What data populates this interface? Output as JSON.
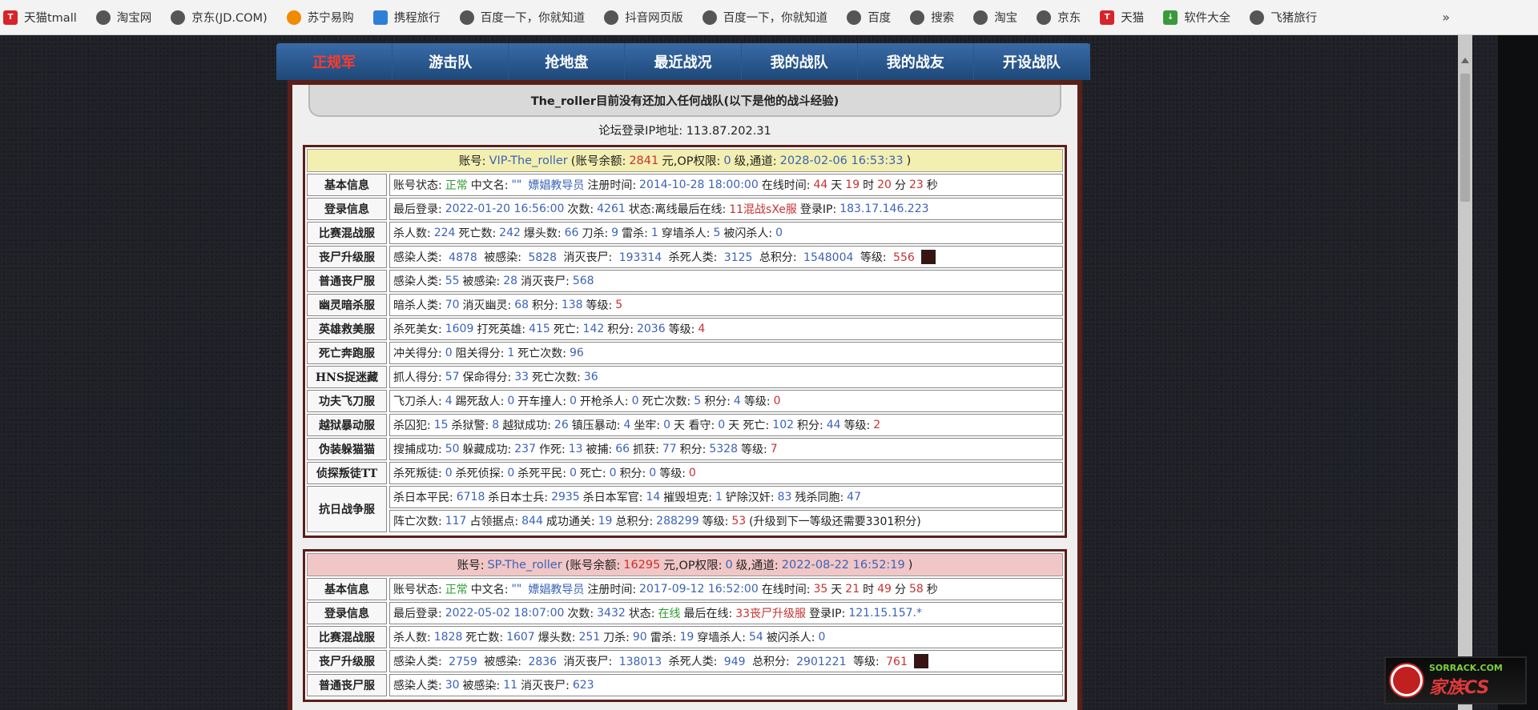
{
  "bookmarks": [
    {
      "label": "天猫tmall",
      "icon": "tmall-icon"
    },
    {
      "label": "淘宝网",
      "icon": "globe-icon"
    },
    {
      "label": "京东(JD.COM)",
      "icon": "globe-icon"
    },
    {
      "label": "苏宁易购",
      "icon": "suning-icon"
    },
    {
      "label": "携程旅行",
      "icon": "ctrip-icon"
    },
    {
      "label": "百度一下，你就知道",
      "icon": "globe-icon"
    },
    {
      "label": "抖音网页版",
      "icon": "globe-icon"
    },
    {
      "label": "百度一下，你就知道",
      "icon": "globe-icon"
    },
    {
      "label": "百度",
      "icon": "globe-icon"
    },
    {
      "label": "搜索",
      "icon": "globe-icon"
    },
    {
      "label": "淘宝",
      "icon": "globe-icon"
    },
    {
      "label": "京东",
      "icon": "globe-icon"
    },
    {
      "label": "天猫",
      "icon": "tmall-icon"
    },
    {
      "label": "软件大全",
      "icon": "download-icon"
    },
    {
      "label": "飞猪旅行",
      "icon": "globe-icon"
    }
  ],
  "bookmarks_more": "»",
  "nav": {
    "tabs": [
      "正规军",
      "游击队",
      "抢地盘",
      "最近战况",
      "我的战队",
      "我的战友",
      "开设战队"
    ],
    "active_index": 0
  },
  "panel": {
    "title": "The_roller目前没有还加入任何战队(以下是他的战斗经验)",
    "ip_label": "论坛登录IP地址:",
    "ip_value": "113.87.202.31"
  },
  "vip": {
    "head": {
      "prefix": "账号:",
      "account": "VIP-The_roller",
      "balance_label": "(账号余额:",
      "balance": "2841",
      "balance_unit": "元,",
      "op_label": "OP权限:",
      "op": "0",
      "op_unit": "级,",
      "channel_label": "通道:",
      "channel": "2028-02-06 16:53:33",
      "close": ")"
    },
    "basic": {
      "label": "基本信息",
      "status_label": "账号状态:",
      "status": "正常",
      "cn_label": "中文名:",
      "cn_quote": "\"\"",
      "cn": "嫖娼教导员",
      "reg_label": "注册时间:",
      "reg": "2014-10-28 18:00:00",
      "online_label": "在线时间:",
      "online_days": "44",
      "online_h": "19",
      "online_m": "20",
      "online_s": "23"
    },
    "login": {
      "label": "登录信息",
      "last_label": "最后登录:",
      "last": "2022-01-20 16:56:00",
      "count_label": "次数:",
      "count": "4261",
      "state_label": "状态:",
      "state": "离线",
      "last_online_label": "最后在线:",
      "last_online": "11混战sXe服",
      "login_ip_label": "登录IP:",
      "login_ip": "183.17.146.223"
    },
    "rows": [
      {
        "label": "比赛混战服",
        "text": "杀人数: 224 死亡数: 242 爆头数: 66 刀杀: 9 雷杀: 1 穿墙杀人: 5 被闪杀人: 0"
      },
      {
        "label": "丧尸升级服",
        "text": "感染人类: 4878 被感染: 5828 消灭丧尸: 193314 杀死人类: 3125 总积分: 1548004 等级: 556"
      },
      {
        "label": "普通丧尸服",
        "text": "感染人类: 55 被感染: 28 消灭丧尸: 568"
      },
      {
        "label": "幽灵暗杀服",
        "text": "暗杀人类: 70 消灭幽灵: 68 积分: 138 等级: 5"
      },
      {
        "label": "英雄救美服",
        "text": "杀死美女: 1609 打死英雄: 415 死亡: 142 积分: 2036 等级: 4"
      },
      {
        "label": "死亡奔跑服",
        "text": "冲关得分: 0 阻关得分: 1 死亡次数: 96"
      },
      {
        "label": "HNS捉迷藏",
        "text": "抓人得分: 57 保命得分: 33 死亡次数: 36"
      },
      {
        "label": "功夫飞刀服",
        "text": "飞刀杀人: 4 踢死敌人: 0 开车撞人: 0 开枪杀人: 0 死亡次数: 5 积分: 4 等级: 0"
      },
      {
        "label": "越狱暴动服",
        "text": "杀囚犯: 15 杀狱警: 8 越狱成功: 26 镇压暴动: 4 坐牢: 0天 看守: 0天 死亡: 102 积分: 44 等级: 2"
      },
      {
        "label": "伪装躲猫猫",
        "text": "搜捕成功: 50 躲藏成功: 237 作死: 13 被捕: 66 抓获: 77 积分: 5328 等级: 7"
      },
      {
        "label": "侦探叛徒TT",
        "text": "杀死叛徒: 0 杀死侦探: 0 杀死平民: 0 死亡: 0 积分: 0 等级: 0"
      }
    ],
    "kangri": {
      "label": "抗日战争服",
      "line1": "杀日本平民: 6718 杀日本士兵: 2935 杀日本军官: 14 摧毁坦克: 1 铲除汉奸: 83 残杀同胞: 47",
      "line2": "阵亡次数: 117 占领据点: 844 成功通关: 19 总积分: 288299 等级: 53 (升级到下一等级还需要3301积分)"
    }
  },
  "sp": {
    "head": {
      "prefix": "账号:",
      "account": "SP-The_roller",
      "balance_label": "(账号余额:",
      "balance": "16295",
      "balance_unit": "元,",
      "op_label": "OP权限:",
      "op": "0",
      "op_unit": "级,",
      "channel_label": "通道:",
      "channel": "2022-08-22 16:52:19",
      "close": ")"
    },
    "basic": {
      "label": "基本信息",
      "status_label": "账号状态:",
      "status": "正常",
      "cn_label": "中文名:",
      "cn_quote": "\"\"",
      "cn": "嫖娼教导员",
      "reg_label": "注册时间:",
      "reg": "2017-09-12 16:52:00",
      "online_label": "在线时间:",
      "online_days": "35",
      "online_h": "21",
      "online_m": "49",
      "online_s": "58"
    },
    "login": {
      "label": "登录信息",
      "last_label": "最后登录:",
      "last": "2022-05-02 18:07:00",
      "count_label": "次数:",
      "count": "3432",
      "state_label": "状态:",
      "state": "在线",
      "last_online_label": "最后在线:",
      "last_online": "33丧尸升级服",
      "login_ip_label": "登录IP:",
      "login_ip": "121.15.157.*"
    },
    "rows": [
      {
        "label": "比赛混战服",
        "text": "杀人数: 1828 死亡数: 1607 爆头数: 251 刀杀: 90 雷杀: 19 穿墙杀人: 54 被闪杀人: 0"
      },
      {
        "label": "丧尸升级服",
        "text": "感染人类: 2759 被感染: 2836 消灭丧尸: 138013 杀死人类: 949 总积分: 2901221 等级: 761"
      },
      {
        "label": "普通丧尸服",
        "text": "感染人类: 30 被感染: 11 消灭丧尸: 623"
      }
    ]
  },
  "time_units": {
    "day": "天",
    "hour": "时",
    "min": "分",
    "sec": "秒"
  },
  "watermark": {
    "site": "SORRACK.COM",
    "brand": "家族CS"
  }
}
